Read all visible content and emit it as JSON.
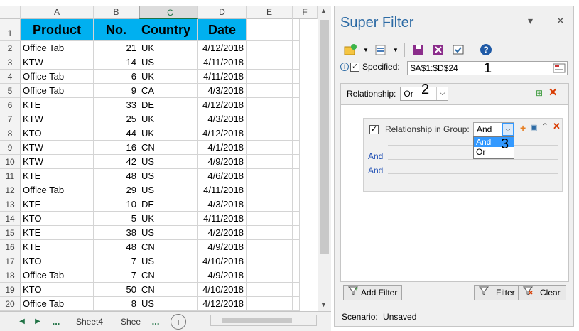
{
  "sheet": {
    "columns": [
      "A",
      "B",
      "C",
      "D",
      "E",
      "F"
    ],
    "header_row": {
      "product": "Product",
      "no": "No.",
      "country": "Country",
      "date": "Date"
    },
    "rows": [
      {
        "rownum": "1"
      },
      {
        "rownum": "2",
        "product": "Office Tab",
        "no": "21",
        "country": "UK",
        "date": "4/12/2018"
      },
      {
        "rownum": "3",
        "product": "KTW",
        "no": "14",
        "country": "US",
        "date": "4/11/2018"
      },
      {
        "rownum": "4",
        "product": "Office Tab",
        "no": "6",
        "country": "UK",
        "date": "4/11/2018"
      },
      {
        "rownum": "5",
        "product": "Office Tab",
        "no": "9",
        "country": "CA",
        "date": "4/3/2018"
      },
      {
        "rownum": "6",
        "product": "KTE",
        "no": "33",
        "country": "DE",
        "date": "4/12/2018"
      },
      {
        "rownum": "7",
        "product": "KTW",
        "no": "25",
        "country": "UK",
        "date": "4/3/2018"
      },
      {
        "rownum": "8",
        "product": "KTO",
        "no": "44",
        "country": "UK",
        "date": "4/12/2018"
      },
      {
        "rownum": "9",
        "product": "KTW",
        "no": "16",
        "country": "CN",
        "date": "4/1/2018"
      },
      {
        "rownum": "10",
        "product": "KTW",
        "no": "42",
        "country": "US",
        "date": "4/9/2018"
      },
      {
        "rownum": "11",
        "product": "KTE",
        "no": "48",
        "country": "US",
        "date": "4/6/2018"
      },
      {
        "rownum": "12",
        "product": "Office Tab",
        "no": "29",
        "country": "US",
        "date": "4/11/2018"
      },
      {
        "rownum": "13",
        "product": "KTE",
        "no": "10",
        "country": "DE",
        "date": "4/3/2018"
      },
      {
        "rownum": "14",
        "product": "KTO",
        "no": "5",
        "country": "UK",
        "date": "4/11/2018"
      },
      {
        "rownum": "15",
        "product": "KTE",
        "no": "38",
        "country": "US",
        "date": "4/2/2018"
      },
      {
        "rownum": "16",
        "product": "KTE",
        "no": "48",
        "country": "CN",
        "date": "4/9/2018"
      },
      {
        "rownum": "17",
        "product": "KTO",
        "no": "7",
        "country": "US",
        "date": "4/10/2018"
      },
      {
        "rownum": "18",
        "product": "Office Tab",
        "no": "7",
        "country": "CN",
        "date": "4/9/2018"
      },
      {
        "rownum": "19",
        "product": "KTO",
        "no": "50",
        "country": "CN",
        "date": "4/10/2018"
      },
      {
        "rownum": "20",
        "product": "Office Tab",
        "no": "8",
        "country": "US",
        "date": "4/12/2018"
      }
    ],
    "header_fill": "#00b0f0",
    "tabs": {
      "dots": "...",
      "sheet4": "Sheet4",
      "sheet_partial": "Shee",
      "dots2": "...",
      "plus": "+"
    }
  },
  "panel": {
    "title": "Super Filter",
    "specified_label": "Specified:",
    "specified_checked": true,
    "range_value": "$A$1:$D$24",
    "relationship_label": "Relationship:",
    "relationship_value": "Or",
    "group_label": "Relationship in Group:",
    "group_value": "And",
    "group_options": [
      "And",
      "Or"
    ],
    "and_rows": [
      "And",
      "And"
    ],
    "callouts": [
      "1",
      "2",
      "3"
    ],
    "add_filter": "Add Filter",
    "filter": "Filter",
    "clear": "Clear",
    "scenario_label": "Scenario:",
    "scenario_value": "Unsaved",
    "title_color": "#2d6ba5"
  }
}
